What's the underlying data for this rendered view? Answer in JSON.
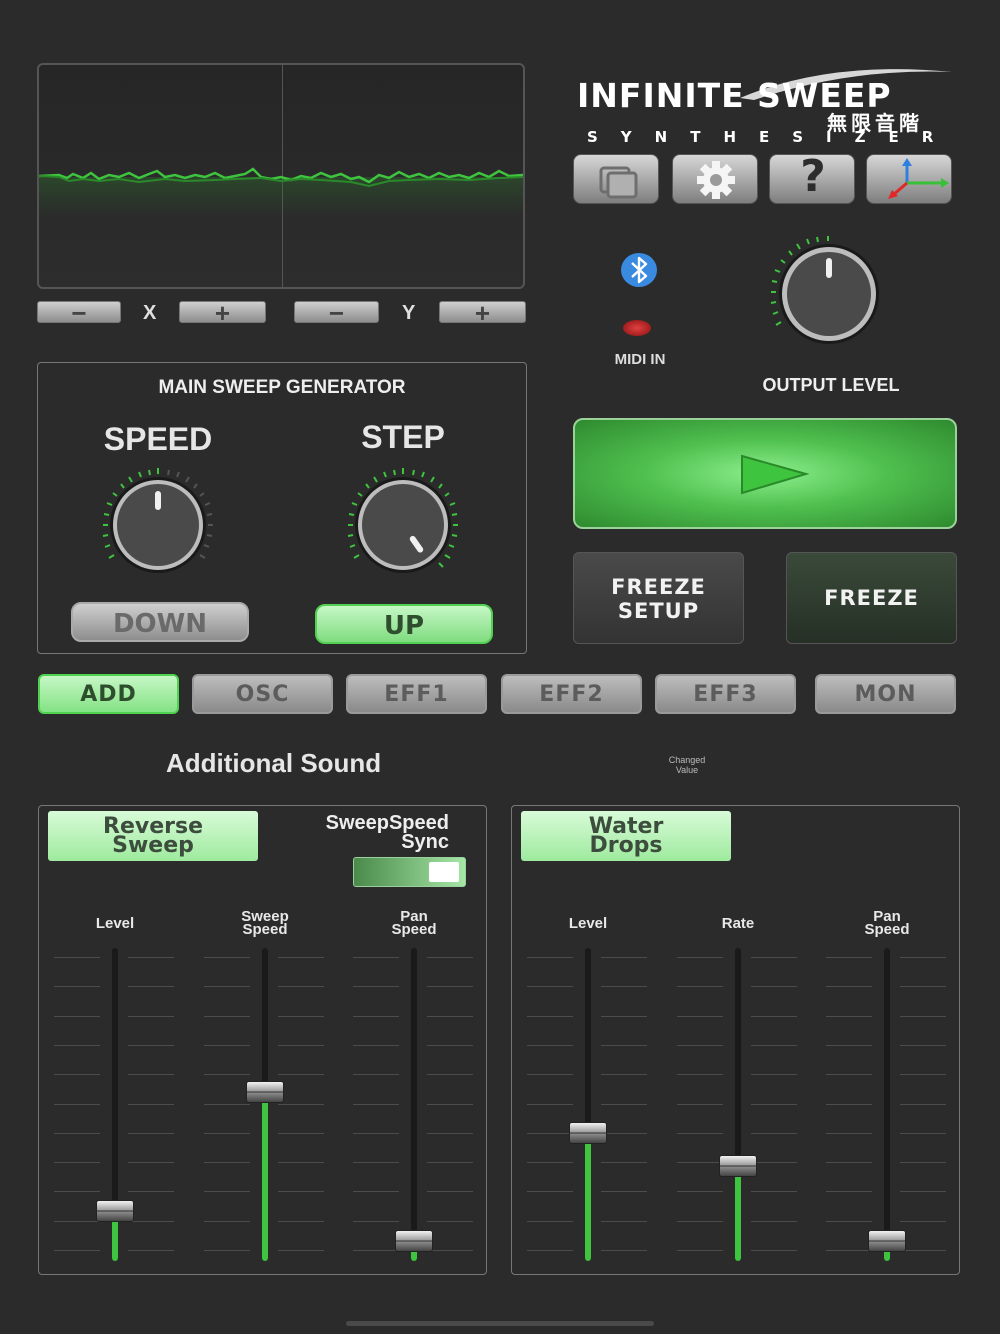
{
  "scope": {
    "x_label": "X",
    "y_label": "Y",
    "minus": "−",
    "plus": "+"
  },
  "logo": {
    "title": "INFINITE SWEEP",
    "jp": "無限音階",
    "sub": "SYNTHESIZER"
  },
  "toolbar": {
    "icons": [
      "copy-icon",
      "gear-icon",
      "help-icon",
      "axes-icon"
    ],
    "help_glyph": "?"
  },
  "status": {
    "midi_in": "MIDI IN",
    "output_level": "OUTPUT LEVEL",
    "bluetooth_icon": "bluetooth-icon",
    "midi_led_color": "#c21e1e"
  },
  "generator": {
    "title": "MAIN SWEEP GENERATOR",
    "speed_label": "SPEED",
    "step_label": "STEP",
    "down_label": "DOWN",
    "up_label": "UP",
    "selected_direction": "UP"
  },
  "freeze": {
    "setup_line1": "FREEZE",
    "setup_line2": "SETUP",
    "freeze_label": "FREEZE"
  },
  "tabs": [
    {
      "label": "ADD",
      "active": true
    },
    {
      "label": "OSC",
      "active": false
    },
    {
      "label": "EFF1",
      "active": false
    },
    {
      "label": "EFF2",
      "active": false
    },
    {
      "label": "EFF3",
      "active": false
    },
    {
      "label": "MON",
      "active": false
    }
  ],
  "section": {
    "title": "Additional Sound",
    "changed_line1": "Changed",
    "changed_line2": "Value"
  },
  "left_panel": {
    "toggle_line1": "Reverse",
    "toggle_line2": "Sweep",
    "sync_line1": "SweepSpeed",
    "sync_line2": "Sync",
    "sync_on": true,
    "faders": [
      {
        "label1": "Level",
        "label2": "",
        "value": 0.12
      },
      {
        "label1": "Sweep",
        "label2": "Speed",
        "value": 0.52
      },
      {
        "label1": "Pan",
        "label2": "Speed",
        "value": 0.02
      }
    ]
  },
  "right_panel": {
    "toggle_line1": "Water",
    "toggle_line2": "Drops",
    "faders": [
      {
        "label1": "Level",
        "label2": "",
        "value": 0.38
      },
      {
        "label1": "Rate",
        "label2": "",
        "value": 0.27
      },
      {
        "label1": "Pan",
        "label2": "Speed",
        "value": 0.02
      }
    ]
  },
  "colors": {
    "accent_green": "#3ec43e",
    "background": "#2b2b2b"
  }
}
